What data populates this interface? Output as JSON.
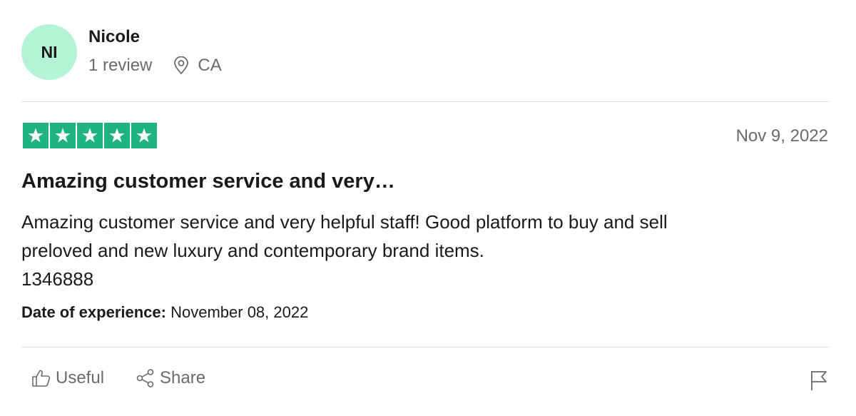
{
  "consumer": {
    "initials": "NI",
    "name": "Nicole",
    "review_count": "1 review",
    "location": "CA",
    "avatar_color": "#b5f3d6"
  },
  "review": {
    "rating": 5,
    "star_color": "#1db480",
    "date": "Nov 9, 2022",
    "title": "Amazing customer service and very…",
    "body_lines": [
      "Amazing customer service and very helpful staff! Good platform to buy and sell",
      "preloved and new luxury and contemporary brand items.",
      "1346888"
    ],
    "experience_label": "Date of experience:",
    "experience_date": "November 08, 2022"
  },
  "actions": {
    "useful_label": "Useful",
    "share_label": "Share",
    "useful_icon": "thumbs-up-icon",
    "share_icon": "share-icon",
    "report_icon": "flag-icon"
  }
}
